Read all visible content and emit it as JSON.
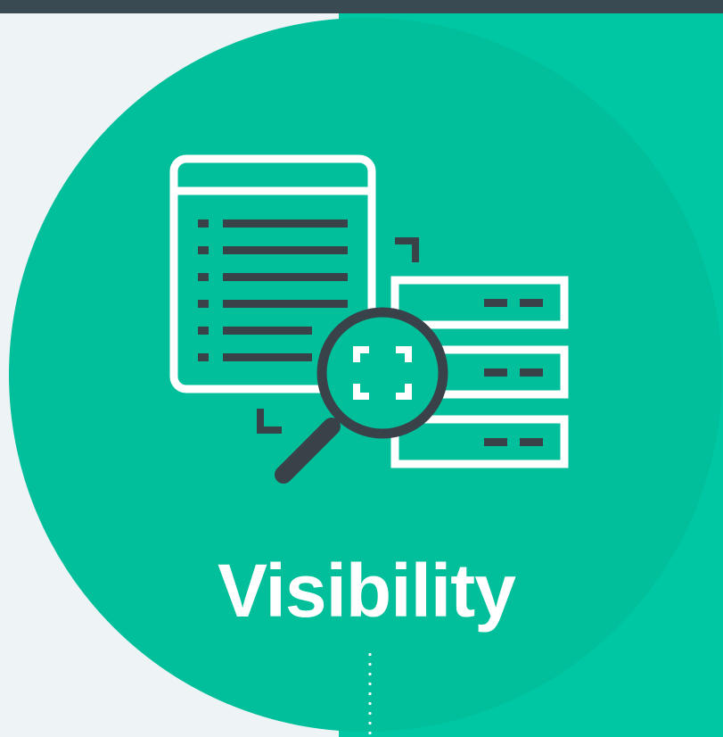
{
  "title": "Visibility",
  "colors": {
    "top_bar": "#394a52",
    "background": "#eef3f6",
    "right_panel": "#00c7a3",
    "circle": "#00bf9a",
    "icon_stroke": "#ffffff",
    "icon_dark": "#3a4249"
  },
  "icons": [
    "document-list-icon",
    "server-stack-icon",
    "magnifier-icon",
    "focus-frame-icon"
  ]
}
